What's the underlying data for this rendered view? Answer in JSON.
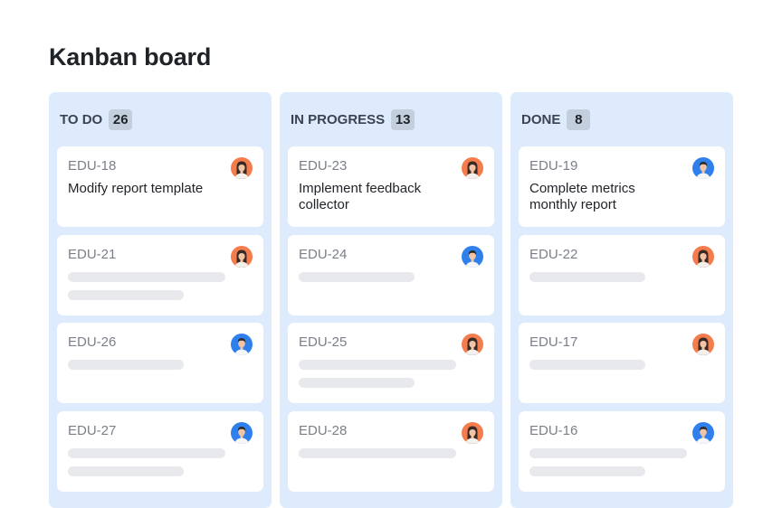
{
  "page": {
    "title": "Kanban board"
  },
  "colors": {
    "column_bg": "#deebfd",
    "avatar_orange": "#f57c4d",
    "avatar_blue": "#2f80ed"
  },
  "columns": [
    {
      "name": "TO DO",
      "count": "26",
      "cards": [
        {
          "id": "EDU-18",
          "title": "Modify report template",
          "avatar": "woman-avatar"
        },
        {
          "id": "EDU-21",
          "title": "",
          "avatar": "woman-avatar"
        },
        {
          "id": "EDU-26",
          "title": "",
          "avatar": "man-avatar"
        },
        {
          "id": "EDU-27",
          "title": "",
          "avatar": "man-avatar"
        }
      ]
    },
    {
      "name": "IN PROGRESS",
      "count": "13",
      "cards": [
        {
          "id": "EDU-23",
          "title": "Implement feedback collector",
          "avatar": "woman-avatar"
        },
        {
          "id": "EDU-24",
          "title": "",
          "avatar": "man-avatar"
        },
        {
          "id": "EDU-25",
          "title": "",
          "avatar": "woman-avatar"
        },
        {
          "id": "EDU-28",
          "title": "",
          "avatar": "woman-avatar"
        }
      ]
    },
    {
      "name": "DONE",
      "count": "8",
      "cards": [
        {
          "id": "EDU-19",
          "title": "Complete metrics monthly report",
          "avatar": "man-avatar"
        },
        {
          "id": "EDU-22",
          "title": "",
          "avatar": "woman-avatar"
        },
        {
          "id": "EDU-17",
          "title": "",
          "avatar": "woman-avatar"
        },
        {
          "id": "EDU-16",
          "title": "",
          "avatar": "man-avatar"
        }
      ]
    }
  ]
}
